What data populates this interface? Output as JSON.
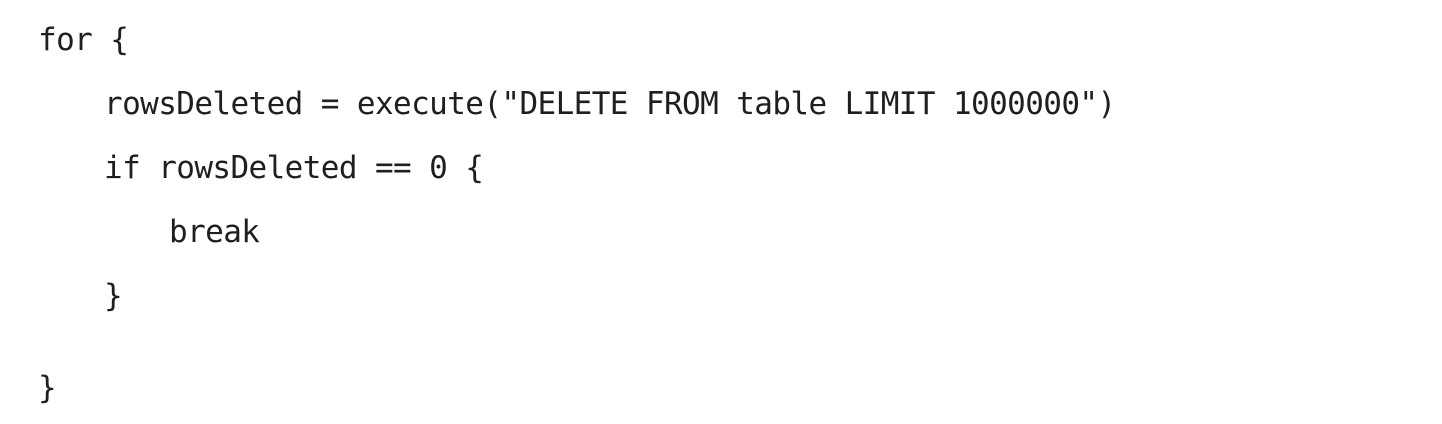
{
  "code": {
    "lines": [
      "for {",
      "rowsDeleted = execute(\"DELETE FROM table LIMIT 1000000\")",
      "if rowsDeleted == 0 {",
      "break",
      "}",
      "}"
    ]
  }
}
